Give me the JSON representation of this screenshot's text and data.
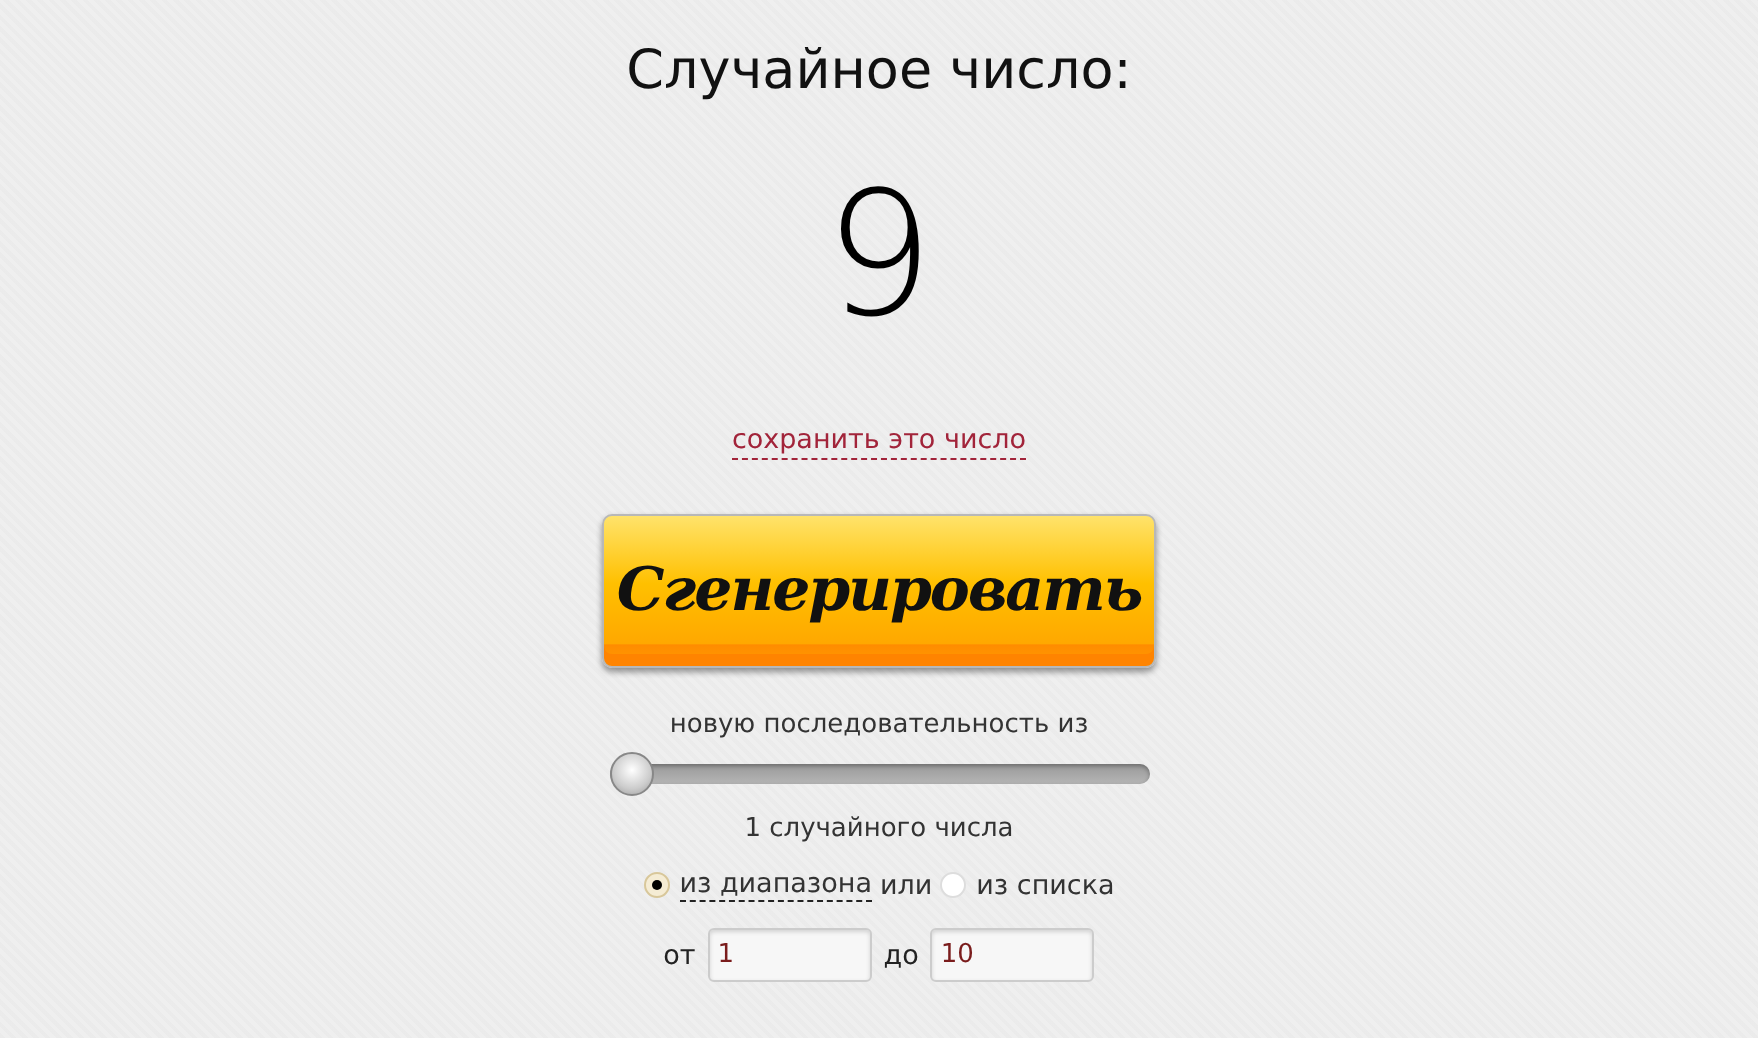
{
  "title": "Случайное число:",
  "result": "9",
  "save_link": "сохранить это число",
  "generate_button": "Сгенерировать",
  "sequence_label": "новую последовательность из",
  "count_slider": {
    "level": 0
  },
  "count_label": "1 случайного числа",
  "modes": [
    {
      "label": "из диапазона",
      "selected": true,
      "kind": "link"
    },
    {
      "label": "или",
      "kind": "text"
    },
    {
      "label": "из списка",
      "selected": false,
      "kind": "plain"
    }
  ],
  "range": [
    {
      "label": "от",
      "value": "1"
    },
    {
      "label": "до",
      "value": "10"
    }
  ]
}
